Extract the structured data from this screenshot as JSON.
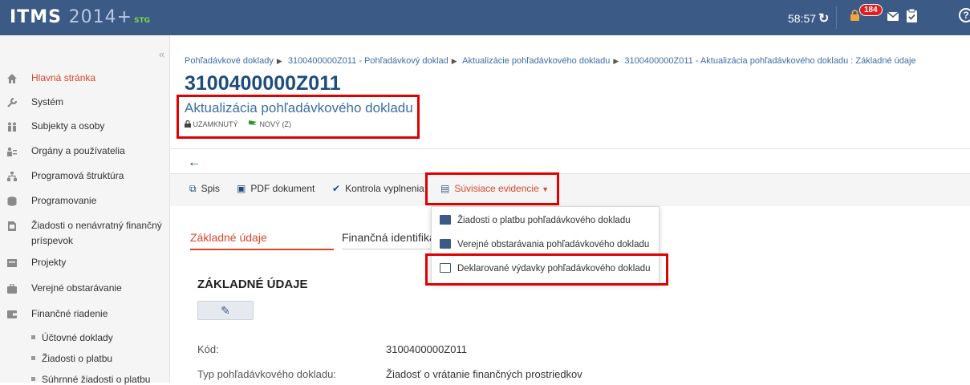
{
  "header": {
    "logo_itms": "ITMS",
    "logo_year": "2014+",
    "logo_env": "STG",
    "timer": "58:57",
    "notifications_count": "184"
  },
  "sidebar": {
    "items": [
      {
        "label": "Hlavná stránka",
        "icon": "home-icon"
      },
      {
        "label": "Systém",
        "icon": "wrench-icon"
      },
      {
        "label": "Subjekty a osoby",
        "icon": "people-icon"
      },
      {
        "label": "Orgány a používatelia",
        "icon": "users-list-icon"
      },
      {
        "label": "Programová štruktúra",
        "icon": "hierarchy-icon"
      },
      {
        "label": "Programovanie",
        "icon": "database-icon"
      },
      {
        "label": "Žiadosti o nenávratný finančný príspevok",
        "icon": "document-icon"
      },
      {
        "label": "Projekty",
        "icon": "folder-icon"
      },
      {
        "label": "Verejné obstarávanie",
        "icon": "briefcase-icon"
      },
      {
        "label": "Finančné riadenie",
        "icon": "wallet-icon"
      }
    ],
    "subitems": [
      "Účtovné doklady",
      "Žiadosti o platbu",
      "Súhrnné žiadosti o platbu"
    ]
  },
  "breadcrumb": [
    "Pohľadávkové doklady",
    "3100400000Z011 - Pohľadávkový doklad",
    "Aktualizácie pohľadávkového dokladu",
    "3100400000Z011 - Aktualizácia pohľadávkového dokladu : Základné údaje"
  ],
  "page": {
    "title": "3100400000Z011",
    "subtitle": "Aktualizácia pohľadávkového dokladu",
    "status_locked": "UZAMKNUTÝ",
    "status_new": "NOVÝ (Z)"
  },
  "toolbar": {
    "spis": "Spis",
    "pdf": "PDF dokument",
    "kontrola": "Kontrola vyplnenia",
    "suvisiace": "Súvisiace evidencie"
  },
  "dropdown": [
    "Žiadosti o platbu pohľadávkového dokladu",
    "Verejné obstarávania pohľadávkového dokladu",
    "Deklarované výdavky pohľadávkového dokladu"
  ],
  "tabs": {
    "zakladne": "Základné údaje",
    "financna": "Finančná identifiká"
  },
  "section": {
    "heading": "ZÁKLADNÉ ÚDAJE"
  },
  "fields": [
    {
      "label": "Kód:",
      "value": "3100400000Z011"
    },
    {
      "label": "Typ pohľadávkového dokladu:",
      "value": "Žiadosť o vrátanie finančných prostriedkov"
    }
  ],
  "colors": {
    "header": "#3c5a86",
    "accent": "#d9472b",
    "link": "#3b6ea5",
    "highlight": "#e00000"
  }
}
